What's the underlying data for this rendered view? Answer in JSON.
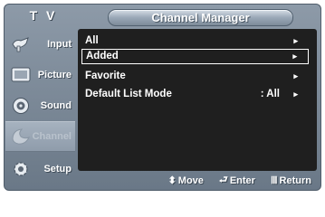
{
  "header": {
    "tv_label": "T V",
    "title": "Channel Manager"
  },
  "sidebar": {
    "items": [
      {
        "label": "Input",
        "icon": "input-icon"
      },
      {
        "label": "Picture",
        "icon": "picture-icon"
      },
      {
        "label": "Sound",
        "icon": "sound-icon"
      },
      {
        "label": "Channel",
        "icon": "channel-icon",
        "active": true
      },
      {
        "label": "Setup",
        "icon": "setup-icon"
      }
    ]
  },
  "menu": {
    "items": [
      {
        "label": "All",
        "value": "",
        "arrow": "▸"
      },
      {
        "label": "Added",
        "value": "",
        "arrow": "▸",
        "selected": true
      },
      {
        "label": "Favorite",
        "value": "",
        "arrow": "▸"
      },
      {
        "label": "Default List Mode",
        "value": ": All",
        "arrow": "▸"
      }
    ]
  },
  "footer": {
    "move": {
      "glyph": "⬍",
      "label": "Move"
    },
    "enter": {
      "glyph": "⮐",
      "label": "Enter"
    },
    "return": {
      "glyph": "Ⅲ",
      "label": "Return"
    }
  },
  "colors": {
    "frame": "#7b8897",
    "panel": "#1f1f1f",
    "text": "#ffffff"
  }
}
